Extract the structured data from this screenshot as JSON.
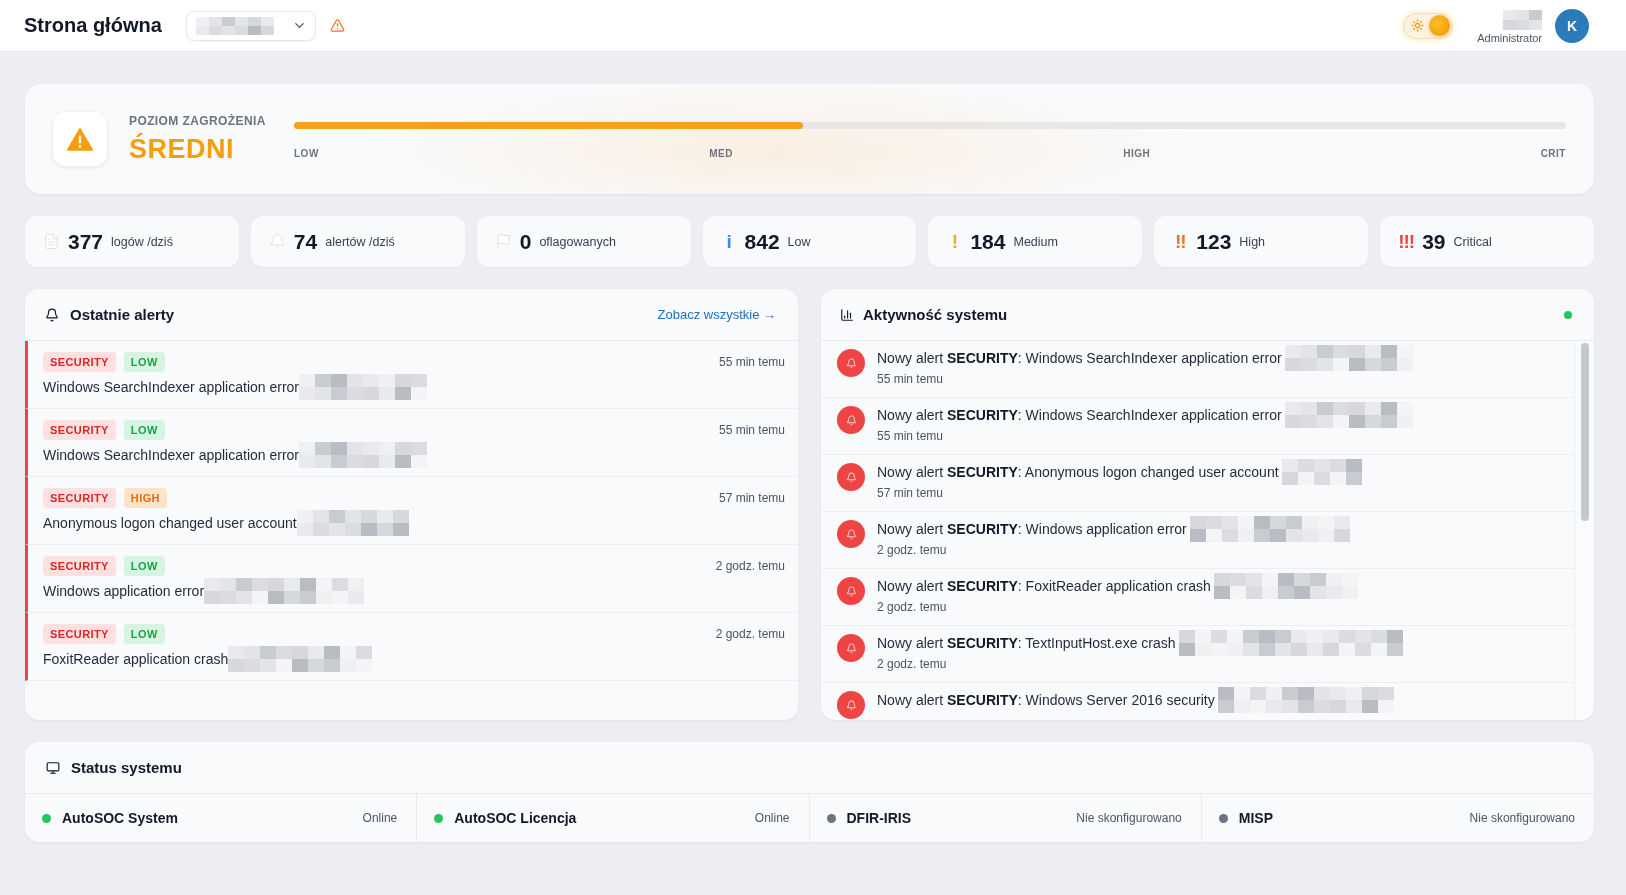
{
  "header": {
    "title": "Strona główna",
    "selector": {
      "redacted": true
    },
    "theme_switch": {
      "checked": true
    },
    "user": {
      "name_redacted": true,
      "role": "Administrator",
      "avatar_letter": "K"
    }
  },
  "threat": {
    "label": "POZIOM ZAGROŻENIA",
    "value": "ŚREDNI",
    "level": 0.4,
    "scale": [
      "LOW",
      "MED",
      "HIGH",
      "CRIT"
    ]
  },
  "stats": [
    {
      "kind": "icon",
      "value": "377",
      "label": "logów /dziś"
    },
    {
      "kind": "icon",
      "value": "74",
      "label": "alertów /dziś"
    },
    {
      "kind": "icon",
      "value": "0",
      "label": "oflagowanych"
    },
    {
      "kind": "symbol",
      "symbol": "i",
      "color": "#3b8fe0",
      "value": "842",
      "label": "Low"
    },
    {
      "kind": "symbol",
      "symbol": "!",
      "color": "#eab308",
      "value": "184",
      "label": "Medium"
    },
    {
      "kind": "symbol",
      "symbol": "!!",
      "color": "#f97316",
      "value": "123",
      "label": "High"
    },
    {
      "kind": "symbol",
      "symbol": "!!!",
      "color": "#ef4444",
      "value": "39",
      "label": "Critical"
    }
  ],
  "recent_alerts": {
    "title": "Ostatnie alerty",
    "link": "Zobacz wszystkie →",
    "items": [
      {
        "tags": [
          {
            "text": "SECURITY",
            "kind": "category"
          },
          {
            "text": "LOW",
            "kind": "low"
          }
        ],
        "title": "Windows SearchIndexer application error",
        "time": "55 min temu",
        "redacted": true
      },
      {
        "tags": [
          {
            "text": "SECURITY",
            "kind": "category"
          },
          {
            "text": "LOW",
            "kind": "low"
          }
        ],
        "title": "Windows SearchIndexer application error",
        "time": "55 min temu",
        "redacted": true
      },
      {
        "tags": [
          {
            "text": "SECURITY",
            "kind": "category"
          },
          {
            "text": "HIGH",
            "kind": "high"
          }
        ],
        "title": "Anonymous logon changed user account",
        "time": "57 min temu",
        "redacted": true
      },
      {
        "tags": [
          {
            "text": "SECURITY",
            "kind": "category"
          },
          {
            "text": "LOW",
            "kind": "low"
          }
        ],
        "title": "Windows application error",
        "time": "2 godz. temu",
        "redacted": true
      },
      {
        "tags": [
          {
            "text": "SECURITY",
            "kind": "category"
          },
          {
            "text": "LOW",
            "kind": "low"
          }
        ],
        "title": "FoxitReader application crash",
        "time": "2 godz. temu",
        "redacted": true
      }
    ]
  },
  "activity": {
    "title": "Aktywność systemu",
    "live": true,
    "items": [
      {
        "text": "Nowy alert **SECURITY**: Windows SearchIndexer application error",
        "time": "55 min temu",
        "redacted": true
      },
      {
        "text": "Nowy alert **SECURITY**: Windows SearchIndexer application error",
        "time": "55 min temu",
        "redacted": true
      },
      {
        "text": "Nowy alert **SECURITY**: Anonymous logon changed user account",
        "time": "57 min temu",
        "redacted": true
      },
      {
        "text": "Nowy alert **SECURITY**: Windows application error",
        "time": "2 godz. temu",
        "redacted": true
      },
      {
        "text": "Nowy alert **SECURITY**: FoxitReader application crash",
        "time": "2 godz. temu",
        "redacted": true
      },
      {
        "text": "Nowy alert **SECURITY**: TextInputHost.exe crash",
        "time": "2 godz. temu",
        "redacted": true
      },
      {
        "text": "Nowy alert **SECURITY**: Windows Server 2016 security",
        "redacted": true
      }
    ]
  },
  "system_status": {
    "title": "Status systemu",
    "services": [
      {
        "name": "AutoSOC System",
        "status": "Online",
        "color": "#22c55e"
      },
      {
        "name": "AutoSOC Licencja",
        "status": "Online",
        "color": "#22c55e"
      },
      {
        "name": "DFIR-IRIS",
        "status": "Nie skonfigurowano",
        "color": "#6b7280"
      },
      {
        "name": "MISP",
        "status": "Nie skonfigurowano",
        "color": "#6b7280"
      }
    ]
  }
}
